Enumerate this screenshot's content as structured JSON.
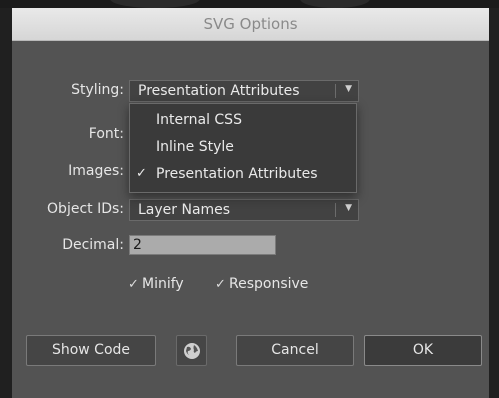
{
  "dialog": {
    "title": "SVG Options"
  },
  "styling": {
    "label": "Styling:",
    "value": "Presentation Attributes"
  },
  "font": {
    "label": "Font:"
  },
  "images": {
    "label": "Images:"
  },
  "styling_menu": {
    "items": [
      {
        "label": "Internal CSS",
        "checked": false
      },
      {
        "label": "Inline Style",
        "checked": false
      },
      {
        "label": "Presentation Attributes",
        "checked": true
      }
    ],
    "check_glyph": "✓"
  },
  "object_ids": {
    "label": "Object IDs:",
    "value": "Layer Names"
  },
  "decimal": {
    "label": "Decimal:",
    "value": "2"
  },
  "options": {
    "minify": {
      "label": "Minify",
      "checked": true
    },
    "responsive": {
      "label": "Responsive",
      "checked": true
    },
    "check_glyph": "✓"
  },
  "buttons": {
    "show_code": "Show Code",
    "globe_icon": "globe-icon",
    "cancel": "Cancel",
    "ok": "OK"
  }
}
